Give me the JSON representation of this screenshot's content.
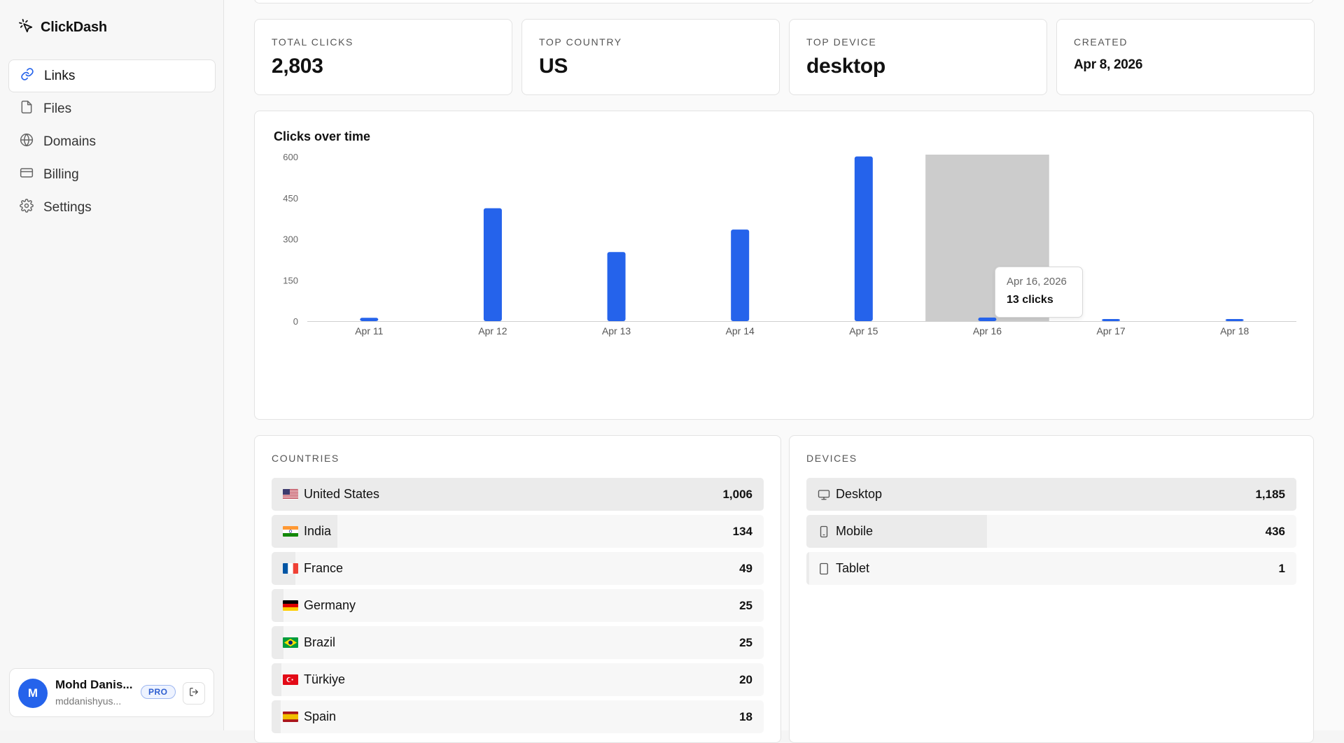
{
  "brand": {
    "name": "ClickDash"
  },
  "sidebar": {
    "items": [
      {
        "label": "Links",
        "icon": "link-icon",
        "active": true
      },
      {
        "label": "Files",
        "icon": "file-icon",
        "active": false
      },
      {
        "label": "Domains",
        "icon": "globe-icon",
        "active": false
      },
      {
        "label": "Billing",
        "icon": "credit-card-icon",
        "active": false
      },
      {
        "label": "Settings",
        "icon": "gear-icon",
        "active": false
      }
    ]
  },
  "user": {
    "initial": "M",
    "name": "Mohd Danis...",
    "email": "mddanishyus...",
    "badge": "PRO"
  },
  "stats": [
    {
      "label": "TOTAL CLICKS",
      "value": "2,803"
    },
    {
      "label": "TOP COUNTRY",
      "value": "US"
    },
    {
      "label": "TOP DEVICE",
      "value": "desktop"
    },
    {
      "label": "CREATED",
      "value": "Apr 8, 2026"
    }
  ],
  "chart_title": "Clicks over time",
  "chart_data": {
    "type": "bar",
    "title": "Clicks over time",
    "xlabel": "",
    "ylabel": "",
    "categories": [
      "Apr 11",
      "Apr 12",
      "Apr 13",
      "Apr 14",
      "Apr 15",
      "Apr 16",
      "Apr 17",
      "Apr 18"
    ],
    "values": [
      12,
      412,
      252,
      334,
      601,
      13,
      6,
      4
    ],
    "ylim": [
      0,
      600
    ],
    "yticks": [
      0,
      150,
      300,
      450,
      600
    ],
    "grid": false,
    "color": "#2563eb",
    "highlight_index": 5
  },
  "tooltip": {
    "date": "Apr 16, 2026",
    "value": "13 clicks"
  },
  "countries": {
    "title": "COUNTRIES",
    "items": [
      {
        "label": "United States",
        "value": "1,006",
        "count": 1006,
        "flag": "us"
      },
      {
        "label": "India",
        "value": "134",
        "count": 134,
        "flag": "in"
      },
      {
        "label": "France",
        "value": "49",
        "count": 49,
        "flag": "fr"
      },
      {
        "label": "Germany",
        "value": "25",
        "count": 25,
        "flag": "de"
      },
      {
        "label": "Brazil",
        "value": "25",
        "count": 25,
        "flag": "br"
      },
      {
        "label": "Türkiye",
        "value": "20",
        "count": 20,
        "flag": "tr"
      },
      {
        "label": "Spain",
        "value": "18",
        "count": 18,
        "flag": "es"
      }
    ]
  },
  "devices": {
    "title": "DEVICES",
    "items": [
      {
        "label": "Desktop",
        "value": "1,185",
        "count": 1185,
        "icon": "monitor-icon"
      },
      {
        "label": "Mobile",
        "value": "436",
        "count": 436,
        "icon": "phone-icon"
      },
      {
        "label": "Tablet",
        "value": "1",
        "count": 1,
        "icon": "tablet-icon"
      }
    ]
  }
}
